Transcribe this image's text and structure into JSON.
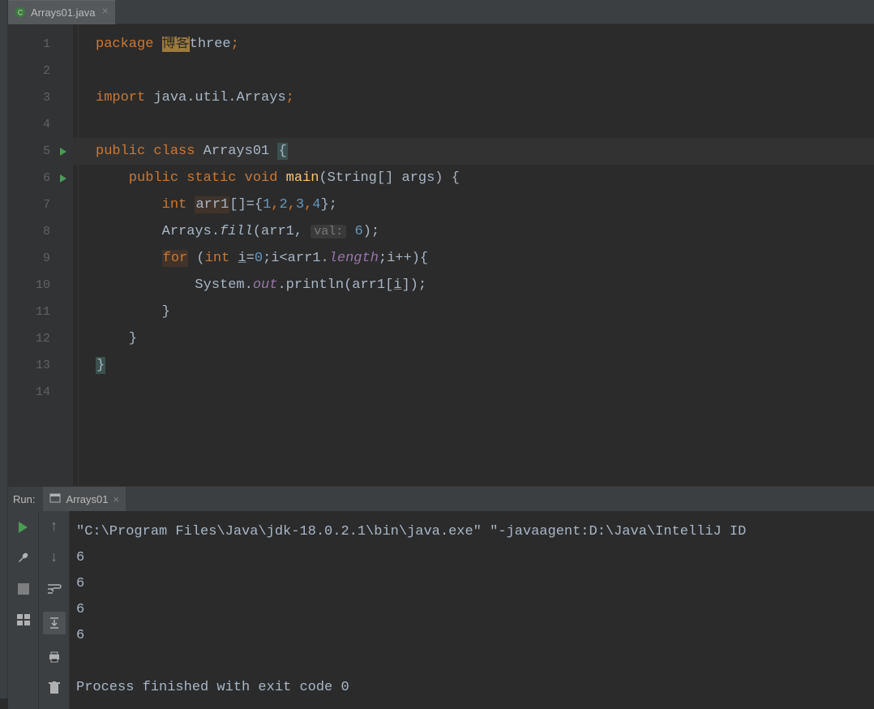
{
  "tab": {
    "label": "Arrays01.java"
  },
  "code": {
    "l1": {
      "pkg": "package",
      "hl": "博客",
      "rest": "three",
      "semi": ";"
    },
    "l3": {
      "imp": "import",
      "path": "java.util.Arrays",
      "semi": ";"
    },
    "l5": {
      "pub": "public class ",
      "name": "Arrays01",
      "brace": " {"
    },
    "l6": {
      "mod": "    public static ",
      "void": "void ",
      "main": "main",
      "args": "(String[] args) {"
    },
    "l7": {
      "indent": "        ",
      "int": "int ",
      "var": "arr1",
      "rest": "[]={",
      "n1": "1",
      "c": ",",
      "n2": "2",
      "n3": "3",
      "n4": "4",
      "close": "};"
    },
    "l8": {
      "indent": "        Arrays.",
      "fill": "fill",
      "open": "(arr1, ",
      "hint": "val:",
      "val": " 6",
      "close": ");"
    },
    "l9": {
      "indent": "        ",
      "for": "for",
      "rest": " (",
      "int": "int ",
      "i": "i",
      "eq": "=",
      "zero": "0",
      "cond": ";i<arr1.",
      "len": "length",
      "inc": ";i++){"
    },
    "l10": {
      "indent": "            System.",
      "out": "out",
      "dot": ".println(arr1[",
      "i": "i",
      "close": "]);"
    },
    "l11": {
      "text": "        }"
    },
    "l12": {
      "text": "    }"
    },
    "l13": {
      "text": "}"
    }
  },
  "line_numbers": [
    "1",
    "2",
    "3",
    "4",
    "5",
    "6",
    "7",
    "8",
    "9",
    "10",
    "11",
    "12",
    "13",
    "14"
  ],
  "run": {
    "label": "Run:",
    "tab": "Arrays01",
    "cmd": "\"C:\\Program Files\\Java\\jdk-18.0.2.1\\bin\\java.exe\" \"-javaagent:D:\\Java\\IntelliJ ID",
    "out1": "6",
    "out2": "6",
    "out3": "6",
    "out4": "6",
    "exit": "Process finished with exit code 0"
  }
}
